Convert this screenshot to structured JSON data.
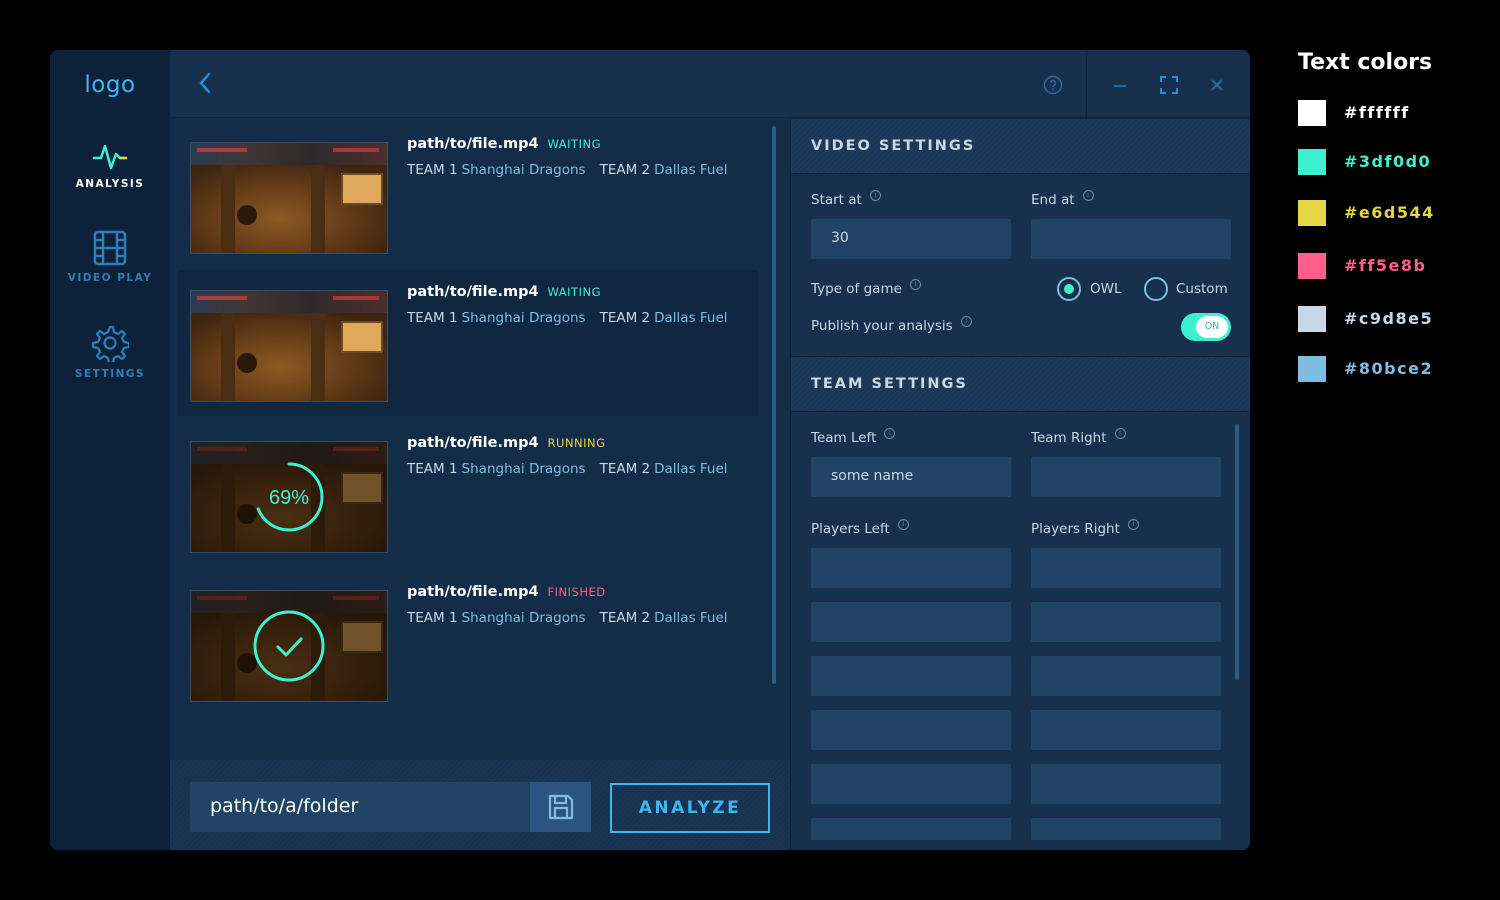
{
  "sidebar": {
    "logo": "logo",
    "items": [
      {
        "label": "ANALYSIS",
        "icon": "pulse-icon",
        "active": true
      },
      {
        "label": "VIDEO PLAY",
        "icon": "film-icon",
        "active": false
      },
      {
        "label": "SETTINGS",
        "icon": "gear-icon",
        "active": false
      }
    ]
  },
  "topbar": {
    "back_icon": "chevron-left-icon",
    "help_icon": "help-icon",
    "minimize_icon": "minimize-icon",
    "maximize_icon": "maximize-icon",
    "close_icon": "close-icon"
  },
  "videos": [
    {
      "file": "path/to/file.mp4",
      "status": "WAITING",
      "status_color": "#3df0d0",
      "team1_label": "TEAM 1",
      "team1": "Shanghai Dragons",
      "team2_label": "TEAM 2",
      "team2": "Dallas Fuel",
      "progress": null,
      "selected": false
    },
    {
      "file": "path/to/file.mp4",
      "status": "WAITING",
      "status_color": "#3df0d0",
      "team1_label": "TEAM 1",
      "team1": "Shanghai Dragons",
      "team2_label": "TEAM 2",
      "team2": "Dallas Fuel",
      "progress": null,
      "selected": true
    },
    {
      "file": "path/to/file.mp4",
      "status": "RUNNING",
      "status_color": "#e6d544",
      "team1_label": "TEAM 1",
      "team1": "Shanghai Dragons",
      "team2_label": "TEAM 2",
      "team2": "Dallas Fuel",
      "progress": 0.69,
      "progress_text": "69%",
      "selected": false
    },
    {
      "file": "path/to/file.mp4",
      "status": "FINISHED",
      "status_color": "#ff5e8b",
      "team1_label": "TEAM 1",
      "team1": "Shanghai Dragons",
      "team2_label": "TEAM 2",
      "team2": "Dallas Fuel",
      "progress": 1,
      "selected": false
    }
  ],
  "bottom": {
    "folder_path": "path/to/a/folder",
    "save_icon": "floppy-disk-icon",
    "analyze_label": "ANALYZE"
  },
  "video_settings": {
    "title": "VIDEO SETTINGS",
    "start_label": "Start at",
    "start_value": "30",
    "end_label": "End at",
    "end_value": "",
    "game_type_label": "Type of game",
    "game_options": [
      "OWL",
      "Custom"
    ],
    "game_selected": "OWL",
    "publish_label": "Publish your analysis",
    "publish_toggle": "ON"
  },
  "team_settings": {
    "title": "TEAM SETTINGS",
    "team_left_label": "Team Left",
    "team_left_value": "some name",
    "team_right_label": "Team Right",
    "team_right_value": "",
    "players_left_label": "Players Left",
    "players_right_label": "Players Right"
  },
  "legend": {
    "title": "Text colors",
    "colors": [
      "#ffffff",
      "#3df0d0",
      "#e6d544",
      "#ff5e8b",
      "#c9d8e5",
      "#80bce2"
    ]
  }
}
